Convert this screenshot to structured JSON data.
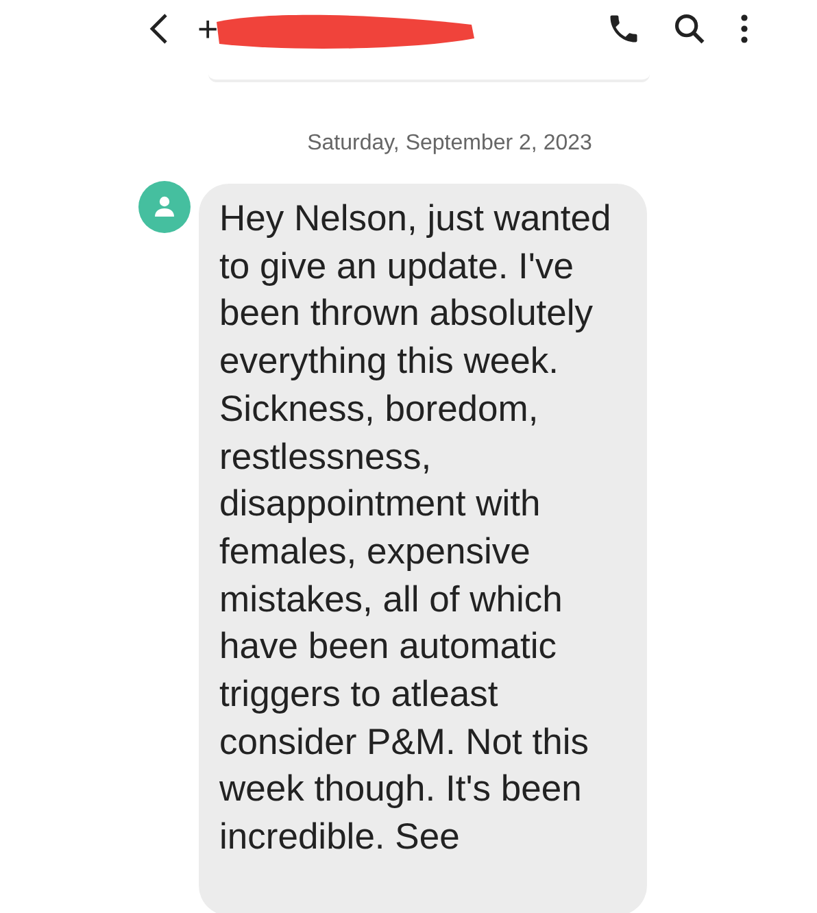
{
  "top_bar": {
    "title": "+"
  },
  "date_divider": "Saturday, September 2, 2023",
  "messages": [
    {
      "kind": "incoming",
      "text": "Hey Nelson, just wanted to give an update. I've been thrown absolutely everything this week. Sickness, boredom, restlessness, disappointment with females, expensive mistakes, all of which have been automatic triggers to atleast consider P&M. Not this week though. It's been incredible. See"
    }
  ]
}
